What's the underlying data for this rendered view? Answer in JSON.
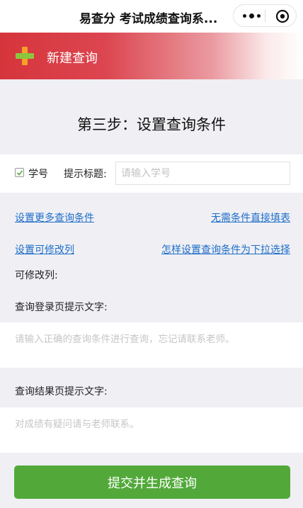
{
  "titlebar": {
    "title": "易查分 考试成绩查询系...",
    "more_icon": "more-dots-icon",
    "close_icon": "target-close-icon"
  },
  "banner": {
    "label": "新建查询",
    "icon": "plus-icon",
    "colors": {
      "red": "#d6343c",
      "plus_vertical": "#f3a227",
      "plus_horizontal": "#8cc63f"
    }
  },
  "step": {
    "heading": "第三步：设置查询条件"
  },
  "condition": {
    "checked": true,
    "field_label": "学号",
    "hint_label": "提示标题:",
    "hint_placeholder": "请输入学号",
    "hint_value": ""
  },
  "links": {
    "more_conditions": "设置更多查询条件",
    "fill_directly": "无需条件直接填表",
    "editable_columns": "设置可修改列",
    "dropdown_condition": "怎样设置查询条件为下拉选择"
  },
  "editable_columns_label": "可修改列:",
  "login_prompt": {
    "label": "查询登录页提示文字:",
    "placeholder": "请输入正确的查询条件进行查询，忘记请联系老师。",
    "value": ""
  },
  "result_prompt": {
    "label": "查询结果页提示文字:",
    "placeholder": "对成绩有疑问请与老师联系。",
    "value": ""
  },
  "submit_label": "提交并生成查询",
  "colors": {
    "link": "#1e6ec8",
    "submit": "#52a93a",
    "background": "#efeff4"
  }
}
